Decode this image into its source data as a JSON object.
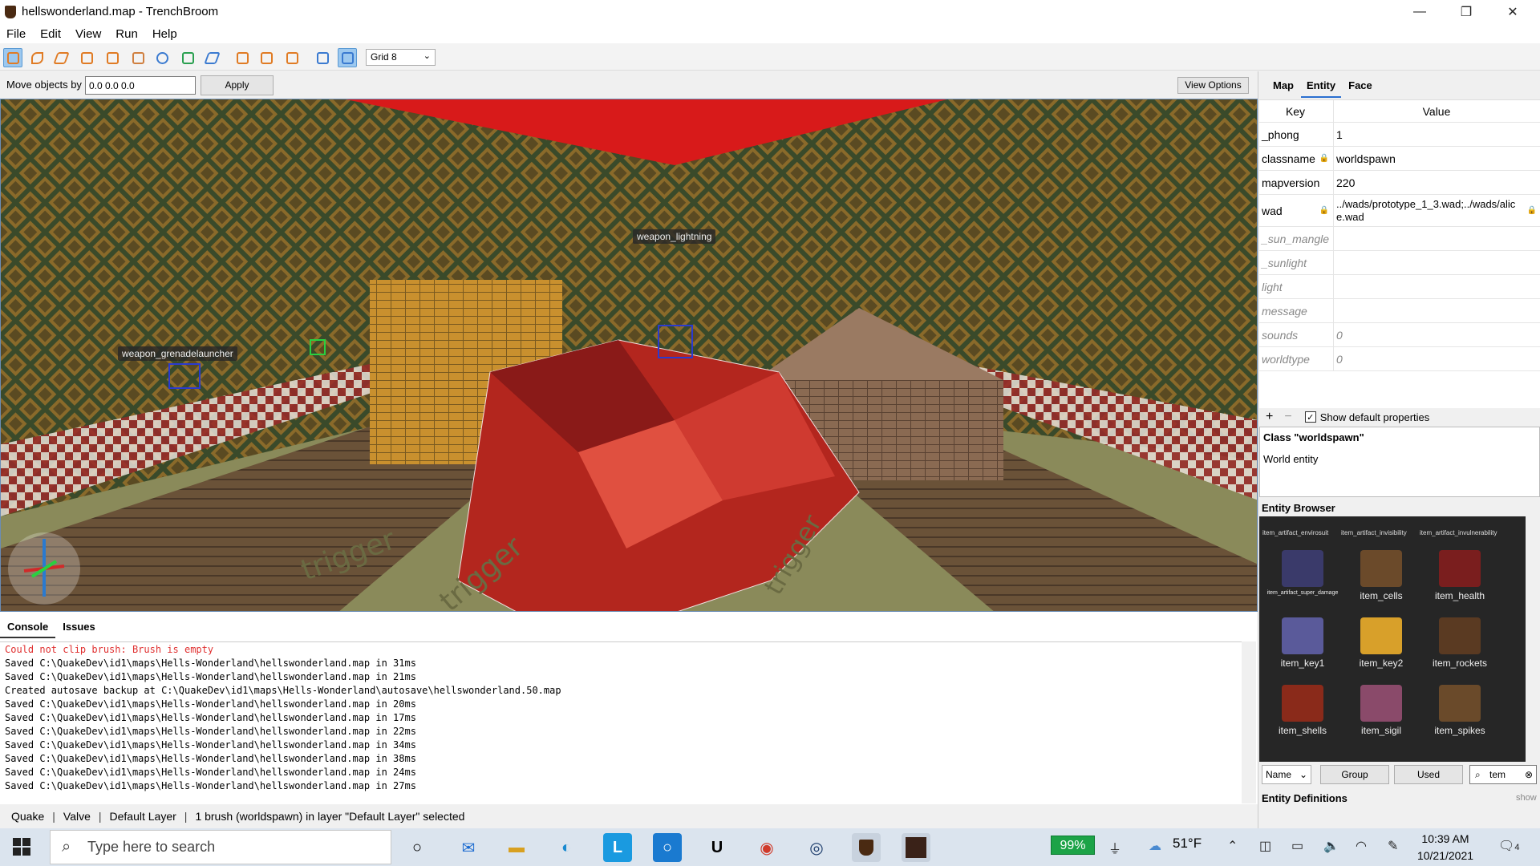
{
  "window": {
    "title": "hellswonderland.map - TrenchBroom",
    "min_icon": "minimize-icon",
    "max_icon": "restore-icon",
    "close_icon": "close-icon"
  },
  "menu": [
    "File",
    "Edit",
    "View",
    "Run",
    "Help"
  ],
  "toolbar": {
    "grid_value": "Grid 8"
  },
  "movebar": {
    "label": "Move objects by",
    "value": "0.0 0.0 0.0",
    "apply": "Apply",
    "view_options": "View Options"
  },
  "viewport": {
    "labels": {
      "lightning": "weapon_lightning",
      "grenade": "weapon_grenadelauncher"
    },
    "floor_text": "trigger"
  },
  "console": {
    "tabs": [
      "Console",
      "Issues"
    ],
    "lines": [
      {
        "text": "Could not clip brush: Brush is empty",
        "error": true
      },
      {
        "text": "Saved C:\\QuakeDev\\id1\\maps\\Hells-Wonderland\\hellswonderland.map in 31ms",
        "error": false
      },
      {
        "text": "Saved C:\\QuakeDev\\id1\\maps\\Hells-Wonderland\\hellswonderland.map in 21ms",
        "error": false
      },
      {
        "text": "Created autosave backup at C:\\QuakeDev\\id1\\maps\\Hells-Wonderland\\autosave\\hellswonderland.50.map",
        "error": false
      },
      {
        "text": "Saved C:\\QuakeDev\\id1\\maps\\Hells-Wonderland\\hellswonderland.map in 20ms",
        "error": false
      },
      {
        "text": "Saved C:\\QuakeDev\\id1\\maps\\Hells-Wonderland\\hellswonderland.map in 17ms",
        "error": false
      },
      {
        "text": "Saved C:\\QuakeDev\\id1\\maps\\Hells-Wonderland\\hellswonderland.map in 22ms",
        "error": false
      },
      {
        "text": "Saved C:\\QuakeDev\\id1\\maps\\Hells-Wonderland\\hellswonderland.map in 34ms",
        "error": false
      },
      {
        "text": "Saved C:\\QuakeDev\\id1\\maps\\Hells-Wonderland\\hellswonderland.map in 38ms",
        "error": false
      },
      {
        "text": "Saved C:\\QuakeDev\\id1\\maps\\Hells-Wonderland\\hellswonderland.map in 24ms",
        "error": false
      },
      {
        "text": "Saved C:\\QuakeDev\\id1\\maps\\Hells-Wonderland\\hellswonderland.map in 27ms",
        "error": false
      }
    ]
  },
  "status": {
    "game": "Quake",
    "format": "Valve",
    "layer": "Default Layer",
    "selection": "1 brush (worldspawn) in layer \"Default Layer\" selected"
  },
  "inspector": {
    "tabs": [
      "Map",
      "Entity",
      "Face"
    ],
    "active_tab": "Entity",
    "headers": {
      "key": "Key",
      "value": "Value"
    },
    "properties": [
      {
        "key": "_phong",
        "value": "1",
        "default": false,
        "lock_key": false,
        "lock_val": false
      },
      {
        "key": "classname",
        "value": "worldspawn",
        "default": false,
        "lock_key": true,
        "lock_val": false
      },
      {
        "key": "mapversion",
        "value": "220",
        "default": false,
        "lock_key": false,
        "lock_val": false
      },
      {
        "key": "wad",
        "value": "../wads/prototype_1_3.wad;../wads/alice.wad",
        "default": false,
        "lock_key": true,
        "lock_val": true
      },
      {
        "key": "_sun_mangle",
        "value": "",
        "default": true,
        "lock_key": false,
        "lock_val": false
      },
      {
        "key": "_sunlight",
        "value": "",
        "default": true,
        "lock_key": false,
        "lock_val": false
      },
      {
        "key": "light",
        "value": "",
        "default": true,
        "lock_key": false,
        "lock_val": false
      },
      {
        "key": "message",
        "value": "",
        "default": true,
        "lock_key": false,
        "lock_val": false
      },
      {
        "key": "sounds",
        "value": "0",
        "default": true,
        "lock_key": false,
        "lock_val": false
      },
      {
        "key": "worldtype",
        "value": "0",
        "default": true,
        "lock_key": false,
        "lock_val": false
      }
    ],
    "show_defaults_label": "Show default properties",
    "show_defaults_checked": true,
    "class_title": "Class \"worldspawn\"",
    "class_desc": "World entity",
    "entity_browser_title": "Entity Browser",
    "entities_top": [
      "item_artifact_envirosuit",
      "item_artifact_invisibility",
      "item_artifact_invulnerability"
    ],
    "entities": [
      {
        "name": "item_artifact_super_damage",
        "color": "#3a3a6a",
        "small": true
      },
      {
        "name": "item_cells",
        "color": "#6b4a2a",
        "small": false
      },
      {
        "name": "item_health",
        "color": "#7a1e1e",
        "small": false
      },
      {
        "name": "item_key1",
        "color": "#5a5a9a",
        "small": false
      },
      {
        "name": "item_key2",
        "color": "#d8a02a",
        "small": false
      },
      {
        "name": "item_rockets",
        "color": "#5a3a22",
        "small": false
      },
      {
        "name": "item_shells",
        "color": "#8a2a1a",
        "small": false
      },
      {
        "name": "item_sigil",
        "color": "#8a4a6a",
        "small": false
      },
      {
        "name": "item_spikes",
        "color": "#6a4a2a",
        "small": false
      }
    ],
    "sort_value": "Name",
    "group_label": "Group",
    "used_label": "Used",
    "search_value": "tem",
    "entity_defs_label": "Entity Definitions",
    "entity_defs_link": "show"
  },
  "taskbar": {
    "search_placeholder": "Type here to search",
    "battery": "99%",
    "weather": "51°F",
    "time": "10:39 AM",
    "date": "10/21/2021",
    "notifications": "4"
  }
}
